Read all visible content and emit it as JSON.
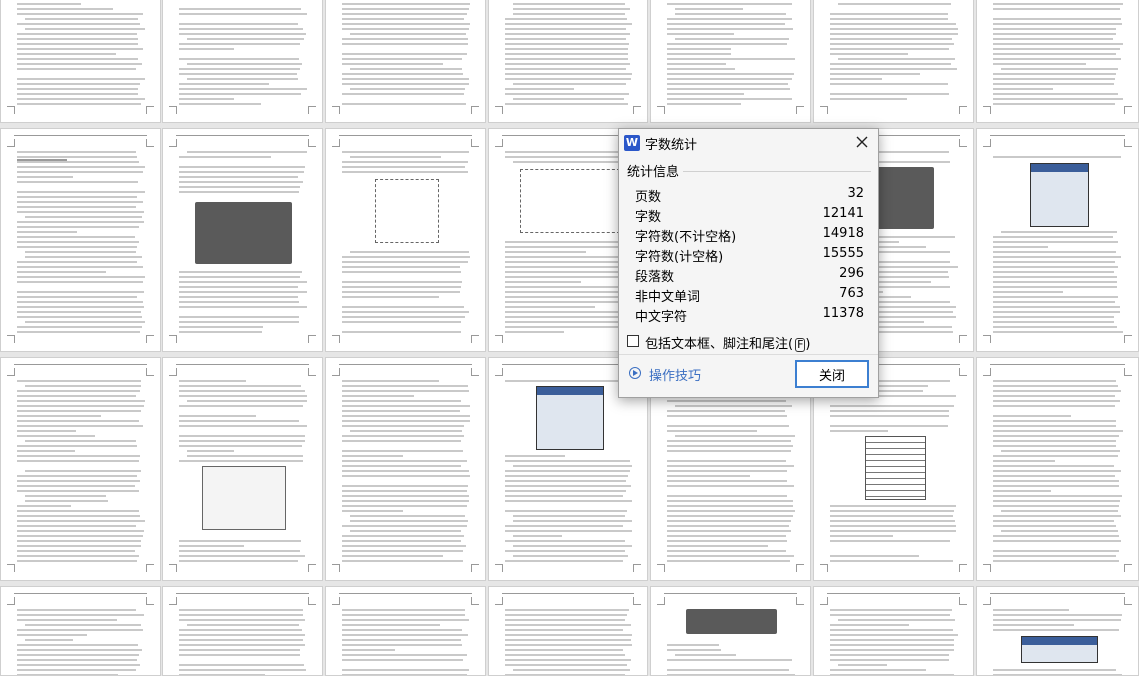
{
  "dialog": {
    "title": "字数统计",
    "app_icon_letter": "W",
    "section_label": "统计信息",
    "rows": [
      {
        "label": "页数",
        "value": "32"
      },
      {
        "label": "字数",
        "value": "12141"
      },
      {
        "label": "字符数(不计空格)",
        "value": "14918"
      },
      {
        "label": "字符数(计空格)",
        "value": "15555"
      },
      {
        "label": "段落数",
        "value": "296"
      },
      {
        "label": "非中文单词",
        "value": "763"
      },
      {
        "label": "中文字符",
        "value": "11378"
      }
    ],
    "checkbox_label": "包括文本框、脚注和尾注",
    "checkbox_key": "F",
    "checkbox_checked": false,
    "tips_label": "操作技巧",
    "close_label": "关闭"
  },
  "colors": {
    "accent": "#3c7fd1",
    "link": "#3b6fc2",
    "app_icon": "#2b57c9",
    "workspace": "#e6e6e6"
  },
  "icons": {
    "app": "wps-writer-icon",
    "close": "close-icon",
    "tips": "play-circle-icon"
  }
}
